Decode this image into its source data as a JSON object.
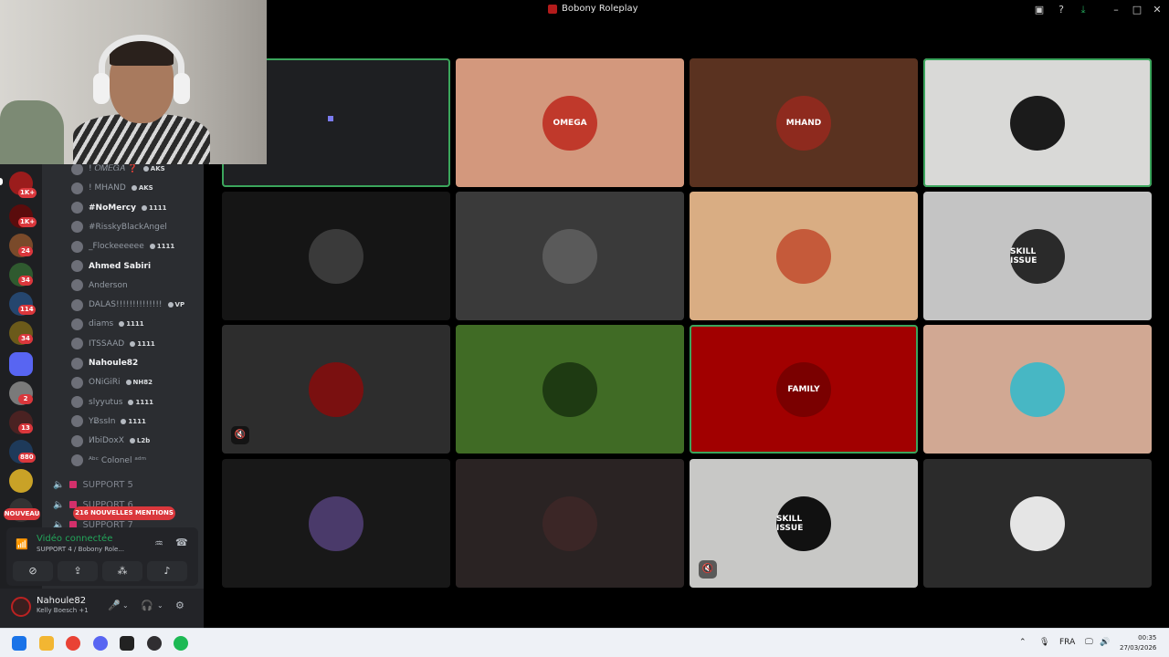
{
  "window": {
    "title": "Bobony Roleplay"
  },
  "titlebar_icons": [
    "inbox-icon",
    "help-icon",
    "download-icon",
    "minimize-icon",
    "maximize-icon",
    "close-icon"
  ],
  "servers": {
    "badges": [
      "1K+",
      "1K+",
      "24",
      "34",
      "114",
      "34",
      "2",
      "13",
      "880"
    ],
    "nouveau": "NOUVEAU"
  },
  "members": [
    {
      "name": "! 𝑂𝑀𝐸𝐺𝐴 ❓",
      "tag": "AKS",
      "bright": false
    },
    {
      "name": "! MHAND",
      "tag": "AKS",
      "bright": false
    },
    {
      "name": "#NoMercy",
      "tag": "1111",
      "bright": true
    },
    {
      "name": "#RisskyBlackAngel",
      "tag": "",
      "bright": false
    },
    {
      "name": "_Flockeeeeee",
      "tag": "1111",
      "bright": false
    },
    {
      "name": "Ahmed Sabiri",
      "tag": "",
      "bright": true
    },
    {
      "name": "Anderson",
      "tag": "",
      "bright": false
    },
    {
      "name": "DALAS!!!!!!!!!!!!!!",
      "tag": "VP",
      "bright": false
    },
    {
      "name": "diams",
      "tag": "1111",
      "bright": false
    },
    {
      "name": "ITSSAAD",
      "tag": "1111",
      "bright": false
    },
    {
      "name": "Nahoule82",
      "tag": "",
      "bright": true
    },
    {
      "name": "ONiGiRi",
      "tag": "NH82",
      "bright": false
    },
    {
      "name": "slyyutus",
      "tag": "1111",
      "bright": false
    },
    {
      "name": "YɃssIn",
      "tag": "1111",
      "bright": false
    },
    {
      "name": "ИbiDoхX",
      "tag": "L2b",
      "bright": false
    },
    {
      "name": "ᴬᵇᶜ Colonel ᵃᵈᵐ",
      "tag": "",
      "bright": false
    }
  ],
  "voice_channels": [
    "SUPPORT 5",
    "SUPPORT 6",
    "SUPPORT 7"
  ],
  "mentions": "216 NOUVELLES MENTIONS",
  "voice": {
    "status": "Vidéo connectée",
    "channel": "SUPPORT 4 / Bobony Role..."
  },
  "user": {
    "name": "Nahoule82",
    "status": "Kelly Boesch +1"
  },
  "tiles": [
    {
      "bg": "#1e1f22",
      "avatar": "none",
      "label": "",
      "speaking": true,
      "muted": false
    },
    {
      "bg": "#d3987d",
      "avatar": "#c0392b",
      "label": "OMEGA",
      "speaking": false,
      "muted": false
    },
    {
      "bg": "#5a3220",
      "avatar": "#8e2a1e",
      "label": "MHAND",
      "speaking": false,
      "muted": false
    },
    {
      "bg": "#d9d9d7",
      "avatar": "#1b1b1b",
      "label": "",
      "speaking": true,
      "muted": false
    },
    {
      "bg": "#151515",
      "avatar": "#3a3a3a",
      "label": "",
      "speaking": false,
      "muted": false
    },
    {
      "bg": "#3a3a3a",
      "avatar": "#5a5a5a",
      "label": "",
      "speaking": false,
      "muted": false
    },
    {
      "bg": "#d9ad83",
      "avatar": "#c55a3a",
      "label": "",
      "speaking": false,
      "muted": false
    },
    {
      "bg": "#c4c4c4",
      "avatar": "#2a2a2a",
      "label": "SKILL ISSUE",
      "speaking": false,
      "muted": false
    },
    {
      "bg": "#2d2d2d",
      "avatar": "#7a1010",
      "label": "",
      "speaking": false,
      "muted": true
    },
    {
      "bg": "#406b25",
      "avatar": "#1e3a12",
      "label": "",
      "speaking": false,
      "muted": false
    },
    {
      "bg": "#a10000",
      "avatar": "#7a0000",
      "label": "FAMILY",
      "speaking": true,
      "muted": false
    },
    {
      "bg": "#d1a893",
      "avatar": "#47b7c4",
      "label": "",
      "speaking": false,
      "muted": false
    },
    {
      "bg": "#181818",
      "avatar": "#4a3a6a",
      "label": "",
      "speaking": false,
      "muted": false
    },
    {
      "bg": "#2a2323",
      "avatar": "#3b2626",
      "label": "",
      "speaking": false,
      "muted": false
    },
    {
      "bg": "#c8c8c6",
      "avatar": "#111111",
      "label": "SKILL ISSUE",
      "speaking": false,
      "muted": true
    },
    {
      "bg": "#2b2b2b",
      "avatar": "#e5e5e5",
      "label": "",
      "speaking": false,
      "muted": false
    }
  ],
  "taskbar": {
    "apps": [
      "windows-start-icon",
      "file-explorer-icon",
      "chrome-icon",
      "discord-icon",
      "capcut-icon",
      "obs-icon",
      "spotify-icon"
    ],
    "lang": "FRA",
    "time": "00:35",
    "date": "27/03/2026"
  }
}
